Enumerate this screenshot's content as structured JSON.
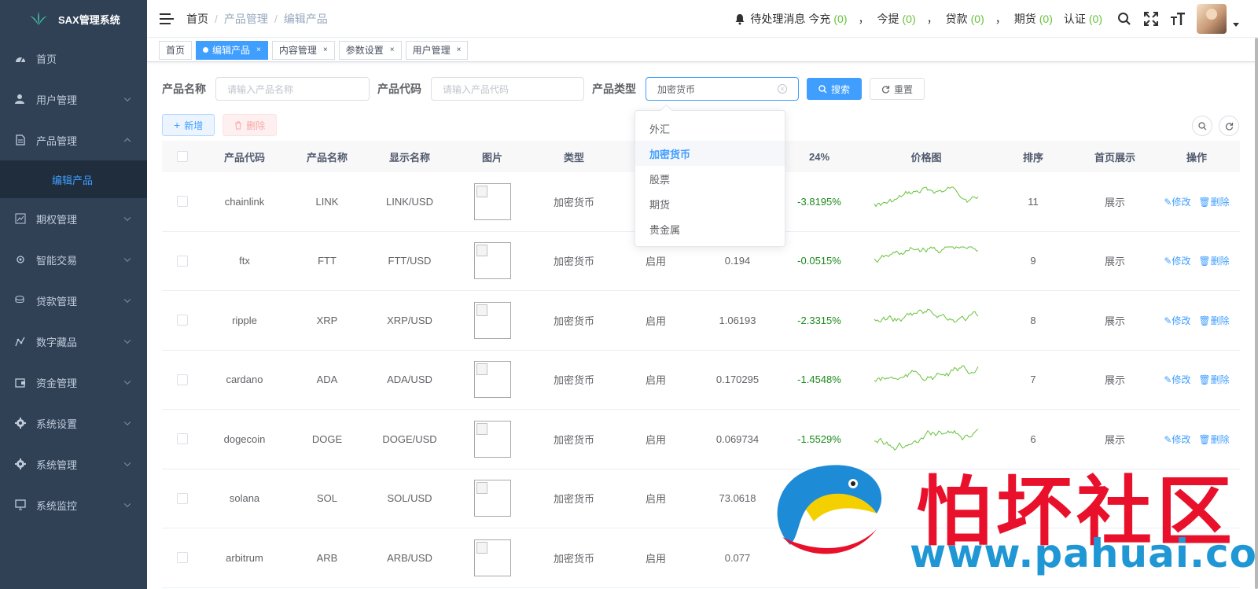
{
  "app": {
    "title": "SAX管理系统"
  },
  "sidebar": {
    "items": [
      {
        "label": "首页",
        "icon": "dashboard-icon"
      },
      {
        "label": "用户管理",
        "icon": "user-icon"
      },
      {
        "label": "产品管理",
        "icon": "document-icon"
      },
      {
        "label": "期权管理",
        "icon": "chart-icon"
      },
      {
        "label": "智能交易",
        "icon": "cpu-icon"
      },
      {
        "label": "贷款管理",
        "icon": "coins-icon"
      },
      {
        "label": "数字藏品",
        "icon": "graph-icon"
      },
      {
        "label": "资金管理",
        "icon": "wallet-icon"
      },
      {
        "label": "系统设置",
        "icon": "gear-icon"
      },
      {
        "label": "系统管理",
        "icon": "gear-icon"
      },
      {
        "label": "系统监控",
        "icon": "monitor-icon"
      }
    ],
    "active_sub": "编辑产品"
  },
  "navbar": {
    "breadcrumb": [
      "首页",
      "产品管理",
      "编辑产品"
    ],
    "pending_label": "待处理消息",
    "recharge_label": "今充",
    "recharge_count": "(0)",
    "withdraw_label": "今提",
    "withdraw_count": "(0)",
    "loan_label": "贷款",
    "loan_count": "(0)",
    "futures_label": "期货",
    "futures_count": "(0)",
    "auth_label": "认证",
    "auth_count": "(0)",
    "comma": "，"
  },
  "tags": [
    {
      "label": "首页",
      "active": false,
      "closable": false
    },
    {
      "label": "编辑产品",
      "active": true,
      "closable": true
    },
    {
      "label": "内容管理",
      "active": false,
      "closable": true
    },
    {
      "label": "参数设置",
      "active": false,
      "closable": true
    },
    {
      "label": "用户管理",
      "active": false,
      "closable": true
    }
  ],
  "search": {
    "name_label": "产品名称",
    "name_placeholder": "请输入产品名称",
    "code_label": "产品代码",
    "code_placeholder": "请输入产品代码",
    "type_label": "产品类型",
    "type_value": "加密货币",
    "search_btn": "搜索",
    "reset_btn": "重置"
  },
  "toolbar": {
    "add_btn": "新增",
    "delete_btn": "删除"
  },
  "dropdown": {
    "options": [
      "外汇",
      "加密货币",
      "股票",
      "期货",
      "贵金属"
    ],
    "selected": "加密货币"
  },
  "table": {
    "headers": {
      "code": "产品代码",
      "name": "产品名称",
      "display": "显示名称",
      "image": "图片",
      "type": "类型",
      "change": "24%",
      "chart": "价格图",
      "sort": "排序",
      "home": "首页展示",
      "ops": "操作"
    },
    "rows": [
      {
        "code": "chainlink",
        "name": "LINK",
        "display": "LINK/USD",
        "type": "加密货币",
        "status": "",
        "price": "",
        "change": "-3.8195%",
        "sort": "11",
        "home": "展示"
      },
      {
        "code": "ftx",
        "name": "FTT",
        "display": "FTT/USD",
        "type": "加密货币",
        "status": "启用",
        "price": "0.194",
        "change": "-0.0515%",
        "sort": "9",
        "home": "展示"
      },
      {
        "code": "ripple",
        "name": "XRP",
        "display": "XRP/USD",
        "type": "加密货币",
        "status": "启用",
        "price": "1.06193",
        "change": "-2.3315%",
        "sort": "8",
        "home": "展示"
      },
      {
        "code": "cardano",
        "name": "ADA",
        "display": "ADA/USD",
        "type": "加密货币",
        "status": "启用",
        "price": "0.170295",
        "change": "-1.4548%",
        "sort": "7",
        "home": "展示"
      },
      {
        "code": "dogecoin",
        "name": "DOGE",
        "display": "DOGE/USD",
        "type": "加密货币",
        "status": "启用",
        "price": "0.069734",
        "change": "-1.5529%",
        "sort": "6",
        "home": "展示"
      },
      {
        "code": "solana",
        "name": "SOL",
        "display": "SOL/USD",
        "type": "加密货币",
        "status": "启用",
        "price": "73.0618",
        "change": "",
        "sort": "",
        "home": ""
      },
      {
        "code": "arbitrum",
        "name": "ARB",
        "display": "ARB/USD",
        "type": "加密货币",
        "status": "启用",
        "price": "0.077",
        "change": "",
        "sort": "",
        "home": ""
      }
    ],
    "edit_label": "修改",
    "delete_label": "删除"
  },
  "colors": {
    "sidebar_bg": "#304156",
    "primary": "#409eff",
    "change_green": "#1c8a1c",
    "sparkline": "#67c23a"
  },
  "watermark": {
    "title": "怕坏社区",
    "url": "www.pahuai.com"
  }
}
